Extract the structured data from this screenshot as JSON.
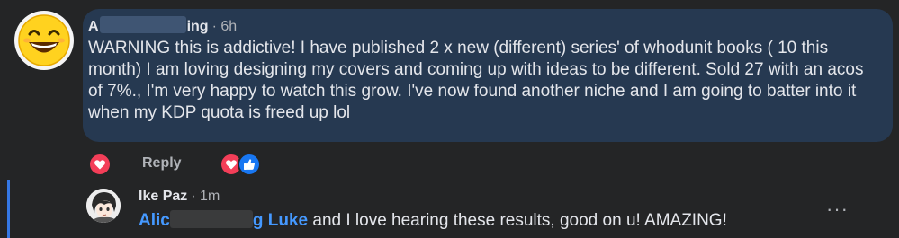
{
  "comment": {
    "author_start": "A",
    "author_end": "ing",
    "separator": "·",
    "time": "6h",
    "text": "WARNING this is addictive! I have published 2 x new (different) series' of whodunit books ( 10 this month) I am loving designing my covers and coming up with ideas to be different. Sold 27 with an acos of 7%., I'm very happy to watch this grow. I've now found another niche and I am going to batter into it when my KDP quota is freed up lol",
    "reply_label": "Reply",
    "bubble_color": "#263951"
  },
  "reply": {
    "author": "Ike Paz",
    "separator": "·",
    "time": "1m",
    "mention_start": "Alic",
    "mention_end": "g Luke",
    "text": " and I love hearing these results, good on u! AMAZING!",
    "more_label": "···",
    "mention_color": "#4599ff"
  },
  "icons": {
    "main_avatar": "laughing-emoji-avatar-icon",
    "reply_avatar": "anime-avatar-icon",
    "heart_reaction": "heart-reaction-icon",
    "like_reaction": "like-reaction-icon",
    "more": "more-options-icon"
  },
  "colors": {
    "background": "#242526",
    "heart": "#f33e58",
    "like": "#1877f2",
    "thread_line": "#3578e5"
  }
}
